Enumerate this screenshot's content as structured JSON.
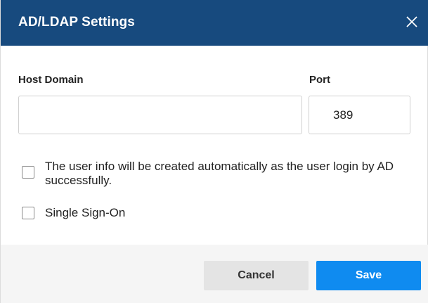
{
  "dialog": {
    "title": "AD/LDAP Settings",
    "close_icon": "close-icon"
  },
  "form": {
    "host_domain": {
      "label": "Host Domain",
      "value": "",
      "placeholder": ""
    },
    "port": {
      "label": "Port",
      "value": "389"
    },
    "auto_create_checkbox": {
      "label": "The user info will be created automatically as the user login by AD successfully.",
      "checked": false
    },
    "sso_checkbox": {
      "label": "Single Sign-On",
      "checked": false
    }
  },
  "footer": {
    "cancel_label": "Cancel",
    "save_label": "Save"
  },
  "colors": {
    "header_bg": "#174a7e",
    "primary": "#0f8bf0",
    "footer_bg": "#f5f5f5"
  }
}
